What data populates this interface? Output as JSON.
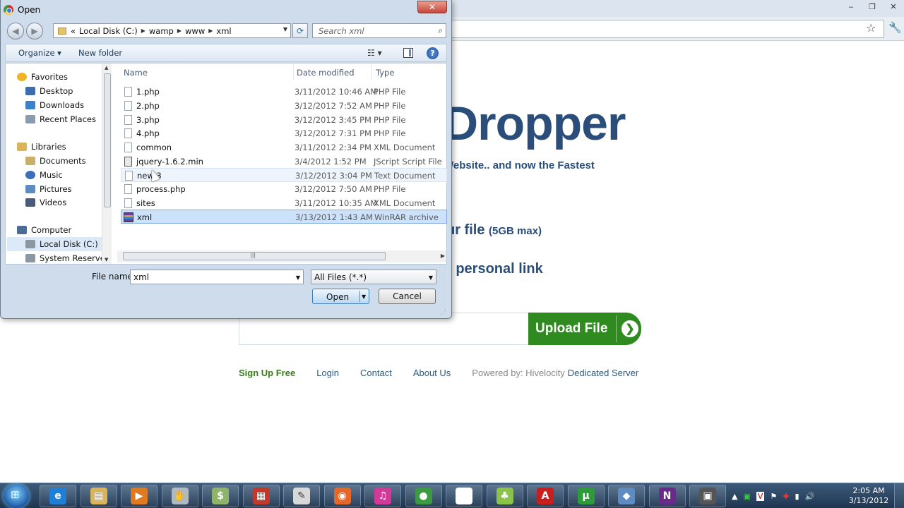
{
  "browser": {
    "window_buttons": [
      "‒",
      "❐",
      "✕"
    ]
  },
  "site": {
    "logo_visible": "Dropper",
    "tagline_visible": "Website.. and now the Fastest",
    "step1_text": "ur file",
    "step1_max": "(5GB max)",
    "step2_text": "r personal link",
    "upload_button": "Upload File",
    "footer": {
      "signup": "Sign Up Free",
      "login": "Login",
      "contact": "Contact",
      "about": "About Us",
      "powered_by": "Powered by: Hivelocity",
      "dedicated": "Dedicated Server"
    }
  },
  "dialog": {
    "title": "Open",
    "close_label": "✕",
    "address": {
      "prefix": "«",
      "crumbs": [
        "Local Disk (C:)",
        "wamp",
        "www",
        "xml"
      ]
    },
    "search_placeholder": "Search xml",
    "toolbar": {
      "organize": "Organize ▾",
      "new_folder": "New folder",
      "help": "?"
    },
    "nav": [
      {
        "label": "Favorites",
        "icon": "star-icon",
        "color": "#f0b323"
      },
      {
        "label": "Desktop",
        "icon": "desktop-icon",
        "color": "#3d6db0"
      },
      {
        "label": "Downloads",
        "icon": "downloads-icon",
        "color": "#3d7fc9"
      },
      {
        "label": "Recent Places",
        "icon": "recent-places-icon",
        "color": "#8a9bb0"
      },
      {
        "label": "Libraries",
        "icon": "libraries-icon",
        "color": "#d9b45a"
      },
      {
        "label": "Documents",
        "icon": "documents-icon",
        "color": "#c9b06a"
      },
      {
        "label": "Music",
        "icon": "music-icon",
        "color": "#3c6fb8"
      },
      {
        "label": "Pictures",
        "icon": "pictures-icon",
        "color": "#5e8cc2"
      },
      {
        "label": "Videos",
        "icon": "videos-icon",
        "color": "#4a5a78"
      },
      {
        "label": "Computer",
        "icon": "computer-icon",
        "color": "#4a6c96"
      },
      {
        "label": "Local Disk (C:)",
        "icon": "disk-icon",
        "color": "#8c97a4"
      },
      {
        "label": "System Reserved",
        "icon": "disk-icon",
        "color": "#8c97a4"
      }
    ],
    "columns": {
      "name": "Name",
      "date": "Date modified",
      "type": "Type"
    },
    "files": [
      {
        "name": "1.php",
        "date": "3/11/2012 10:46 AM",
        "type": "PHP File",
        "icon": "file-icon"
      },
      {
        "name": "2.php",
        "date": "3/12/2012 7:52 AM",
        "type": "PHP File",
        "icon": "file-icon"
      },
      {
        "name": "3.php",
        "date": "3/12/2012 3:45 PM",
        "type": "PHP File",
        "icon": "file-icon"
      },
      {
        "name": "4.php",
        "date": "3/12/2012 7:31 PM",
        "type": "PHP File",
        "icon": "file-icon"
      },
      {
        "name": "common",
        "date": "3/11/2012 2:34 PM",
        "type": "XML Document",
        "icon": "file-icon"
      },
      {
        "name": "jquery-1.6.2.min",
        "date": "3/4/2012 1:52 PM",
        "type": "JScript Script File",
        "icon": "script-file-icon"
      },
      {
        "name": "new 3",
        "date": "3/12/2012 3:04 PM",
        "type": "Text Document",
        "icon": "file-icon"
      },
      {
        "name": "process.php",
        "date": "3/12/2012 7:50 AM",
        "type": "PHP File",
        "icon": "file-icon"
      },
      {
        "name": "sites",
        "date": "3/11/2012 10:35 AM",
        "type": "XML Document",
        "icon": "file-icon"
      },
      {
        "name": "xml",
        "date": "3/13/2012 1:43 AM",
        "type": "WinRAR archive",
        "icon": "winrar-archive-icon"
      }
    ],
    "file_name_label": "File name:",
    "file_name_value": "xml",
    "file_type_value": "All Files (*.*)",
    "open_label": "Open",
    "cancel_label": "Cancel"
  },
  "taskbar": {
    "apps": [
      {
        "name": "internet-explorer",
        "glyph": "e",
        "color": "#1f7fd6"
      },
      {
        "name": "explorer",
        "glyph": "▤",
        "color": "#d9b45a"
      },
      {
        "name": "media-player",
        "glyph": "▶",
        "color": "#e07a20"
      },
      {
        "name": "hand-app",
        "glyph": "✋",
        "color": "#b0b8c0"
      },
      {
        "name": "money-app",
        "glyph": "$",
        "color": "#8fb36a"
      },
      {
        "name": "unknown-app",
        "glyph": "▦",
        "color": "#c0392b"
      },
      {
        "name": "notepad",
        "glyph": "✎",
        "color": "#d8d8d8"
      },
      {
        "name": "firefox",
        "glyph": "◉",
        "color": "#e5672a"
      },
      {
        "name": "itunes-app",
        "glyph": "♫",
        "color": "#d23a9a"
      },
      {
        "name": "chrome",
        "glyph": "●",
        "color": "#3b9a42"
      },
      {
        "name": "blank-doc",
        "glyph": "",
        "color": "#ffffff"
      },
      {
        "name": "android",
        "glyph": "♣",
        "color": "#8ac24a"
      },
      {
        "name": "acrobat",
        "glyph": "A",
        "color": "#c81e1e"
      },
      {
        "name": "utorrent",
        "glyph": "μ",
        "color": "#2f9a3a"
      },
      {
        "name": "virtualbox",
        "glyph": "◆",
        "color": "#5e8cc2"
      },
      {
        "name": "onenote",
        "glyph": "N",
        "color": "#6a2a8a"
      },
      {
        "name": "video-app",
        "glyph": "▣",
        "color": "#555555"
      }
    ],
    "tray_icons": [
      "▲",
      "▣",
      "V",
      "⚑",
      "✚",
      "▮",
      "🔊"
    ],
    "time": "2:05 AM",
    "date": "3/13/2012"
  }
}
